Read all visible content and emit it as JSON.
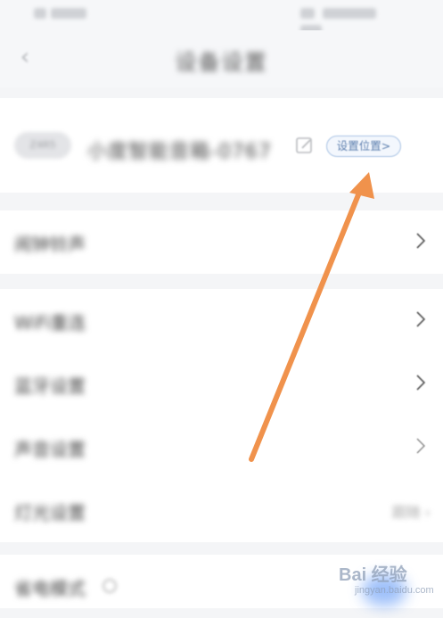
{
  "status_bar": {},
  "header": {
    "back_icon": "‹",
    "title": "设备设置"
  },
  "device": {
    "avatar_text": "Z4R5",
    "name": "小度智能音箱-0767",
    "location_button": "设置位置>"
  },
  "rows": [
    {
      "label": "闹钟铃声"
    },
    {
      "label": "WiFi重连"
    },
    {
      "label": "蓝牙设置"
    },
    {
      "label": "声音设置"
    },
    {
      "label": "灯光设置",
      "value": "跟随 ›"
    },
    {
      "label": "省电模式"
    }
  ],
  "colors": {
    "accent": "#5d7fae",
    "arrow": "#f0924c",
    "background": "#f4f5f7"
  },
  "watermark": {
    "text": "Bai 经验",
    "sub": "jingyan.baidu.com"
  }
}
